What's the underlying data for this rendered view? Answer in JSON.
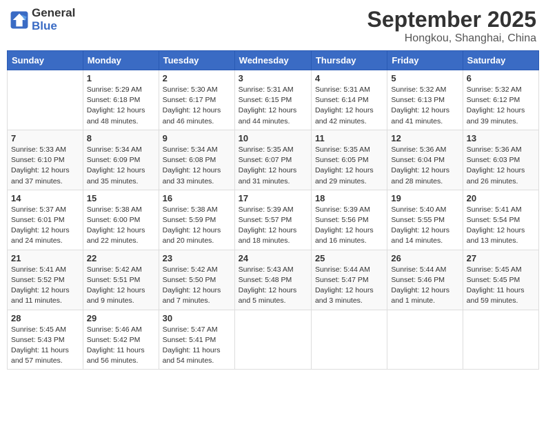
{
  "logo": {
    "line1": "General",
    "line2": "Blue"
  },
  "title": "September 2025",
  "location": "Hongkou, Shanghai, China",
  "days_of_week": [
    "Sunday",
    "Monday",
    "Tuesday",
    "Wednesday",
    "Thursday",
    "Friday",
    "Saturday"
  ],
  "weeks": [
    [
      {
        "day": "",
        "sunrise": "",
        "sunset": "",
        "daylight": ""
      },
      {
        "day": "1",
        "sunrise": "Sunrise: 5:29 AM",
        "sunset": "Sunset: 6:18 PM",
        "daylight": "Daylight: 12 hours and 48 minutes."
      },
      {
        "day": "2",
        "sunrise": "Sunrise: 5:30 AM",
        "sunset": "Sunset: 6:17 PM",
        "daylight": "Daylight: 12 hours and 46 minutes."
      },
      {
        "day": "3",
        "sunrise": "Sunrise: 5:31 AM",
        "sunset": "Sunset: 6:15 PM",
        "daylight": "Daylight: 12 hours and 44 minutes."
      },
      {
        "day": "4",
        "sunrise": "Sunrise: 5:31 AM",
        "sunset": "Sunset: 6:14 PM",
        "daylight": "Daylight: 12 hours and 42 minutes."
      },
      {
        "day": "5",
        "sunrise": "Sunrise: 5:32 AM",
        "sunset": "Sunset: 6:13 PM",
        "daylight": "Daylight: 12 hours and 41 minutes."
      },
      {
        "day": "6",
        "sunrise": "Sunrise: 5:32 AM",
        "sunset": "Sunset: 6:12 PM",
        "daylight": "Daylight: 12 hours and 39 minutes."
      }
    ],
    [
      {
        "day": "7",
        "sunrise": "Sunrise: 5:33 AM",
        "sunset": "Sunset: 6:10 PM",
        "daylight": "Daylight: 12 hours and 37 minutes."
      },
      {
        "day": "8",
        "sunrise": "Sunrise: 5:34 AM",
        "sunset": "Sunset: 6:09 PM",
        "daylight": "Daylight: 12 hours and 35 minutes."
      },
      {
        "day": "9",
        "sunrise": "Sunrise: 5:34 AM",
        "sunset": "Sunset: 6:08 PM",
        "daylight": "Daylight: 12 hours and 33 minutes."
      },
      {
        "day": "10",
        "sunrise": "Sunrise: 5:35 AM",
        "sunset": "Sunset: 6:07 PM",
        "daylight": "Daylight: 12 hours and 31 minutes."
      },
      {
        "day": "11",
        "sunrise": "Sunrise: 5:35 AM",
        "sunset": "Sunset: 6:05 PM",
        "daylight": "Daylight: 12 hours and 29 minutes."
      },
      {
        "day": "12",
        "sunrise": "Sunrise: 5:36 AM",
        "sunset": "Sunset: 6:04 PM",
        "daylight": "Daylight: 12 hours and 28 minutes."
      },
      {
        "day": "13",
        "sunrise": "Sunrise: 5:36 AM",
        "sunset": "Sunset: 6:03 PM",
        "daylight": "Daylight: 12 hours and 26 minutes."
      }
    ],
    [
      {
        "day": "14",
        "sunrise": "Sunrise: 5:37 AM",
        "sunset": "Sunset: 6:01 PM",
        "daylight": "Daylight: 12 hours and 24 minutes."
      },
      {
        "day": "15",
        "sunrise": "Sunrise: 5:38 AM",
        "sunset": "Sunset: 6:00 PM",
        "daylight": "Daylight: 12 hours and 22 minutes."
      },
      {
        "day": "16",
        "sunrise": "Sunrise: 5:38 AM",
        "sunset": "Sunset: 5:59 PM",
        "daylight": "Daylight: 12 hours and 20 minutes."
      },
      {
        "day": "17",
        "sunrise": "Sunrise: 5:39 AM",
        "sunset": "Sunset: 5:57 PM",
        "daylight": "Daylight: 12 hours and 18 minutes."
      },
      {
        "day": "18",
        "sunrise": "Sunrise: 5:39 AM",
        "sunset": "Sunset: 5:56 PM",
        "daylight": "Daylight: 12 hours and 16 minutes."
      },
      {
        "day": "19",
        "sunrise": "Sunrise: 5:40 AM",
        "sunset": "Sunset: 5:55 PM",
        "daylight": "Daylight: 12 hours and 14 minutes."
      },
      {
        "day": "20",
        "sunrise": "Sunrise: 5:41 AM",
        "sunset": "Sunset: 5:54 PM",
        "daylight": "Daylight: 12 hours and 13 minutes."
      }
    ],
    [
      {
        "day": "21",
        "sunrise": "Sunrise: 5:41 AM",
        "sunset": "Sunset: 5:52 PM",
        "daylight": "Daylight: 12 hours and 11 minutes."
      },
      {
        "day": "22",
        "sunrise": "Sunrise: 5:42 AM",
        "sunset": "Sunset: 5:51 PM",
        "daylight": "Daylight: 12 hours and 9 minutes."
      },
      {
        "day": "23",
        "sunrise": "Sunrise: 5:42 AM",
        "sunset": "Sunset: 5:50 PM",
        "daylight": "Daylight: 12 hours and 7 minutes."
      },
      {
        "day": "24",
        "sunrise": "Sunrise: 5:43 AM",
        "sunset": "Sunset: 5:48 PM",
        "daylight": "Daylight: 12 hours and 5 minutes."
      },
      {
        "day": "25",
        "sunrise": "Sunrise: 5:44 AM",
        "sunset": "Sunset: 5:47 PM",
        "daylight": "Daylight: 12 hours and 3 minutes."
      },
      {
        "day": "26",
        "sunrise": "Sunrise: 5:44 AM",
        "sunset": "Sunset: 5:46 PM",
        "daylight": "Daylight: 12 hours and 1 minute."
      },
      {
        "day": "27",
        "sunrise": "Sunrise: 5:45 AM",
        "sunset": "Sunset: 5:45 PM",
        "daylight": "Daylight: 11 hours and 59 minutes."
      }
    ],
    [
      {
        "day": "28",
        "sunrise": "Sunrise: 5:45 AM",
        "sunset": "Sunset: 5:43 PM",
        "daylight": "Daylight: 11 hours and 57 minutes."
      },
      {
        "day": "29",
        "sunrise": "Sunrise: 5:46 AM",
        "sunset": "Sunset: 5:42 PM",
        "daylight": "Daylight: 11 hours and 56 minutes."
      },
      {
        "day": "30",
        "sunrise": "Sunrise: 5:47 AM",
        "sunset": "Sunset: 5:41 PM",
        "daylight": "Daylight: 11 hours and 54 minutes."
      },
      {
        "day": "",
        "sunrise": "",
        "sunset": "",
        "daylight": ""
      },
      {
        "day": "",
        "sunrise": "",
        "sunset": "",
        "daylight": ""
      },
      {
        "day": "",
        "sunrise": "",
        "sunset": "",
        "daylight": ""
      },
      {
        "day": "",
        "sunrise": "",
        "sunset": "",
        "daylight": ""
      }
    ]
  ]
}
